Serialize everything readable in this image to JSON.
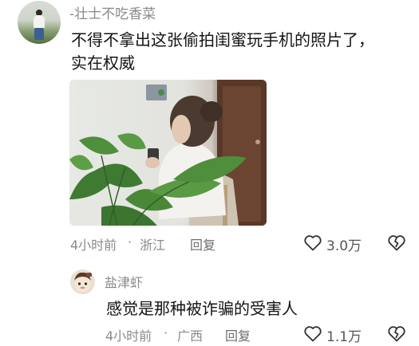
{
  "comment": {
    "username": "-壮士不吃香菜",
    "text_line1": "不得不拿出这张偷拍闺蜜玩手机的照片了，",
    "text_line2": "实在权威",
    "time": "4小时前",
    "dot": "·",
    "location": "浙江",
    "reply_label": "回复",
    "likes": "3.0万",
    "like_icon": "heart-outline-icon",
    "dislike_icon": "broken-heart-icon"
  },
  "reply": {
    "username": "盐津虾",
    "text": "感觉是那种被诈骗的受害人",
    "time": "4小时前",
    "dot": "·",
    "location": "广西",
    "reply_label": "回复",
    "likes": "1.1万"
  }
}
